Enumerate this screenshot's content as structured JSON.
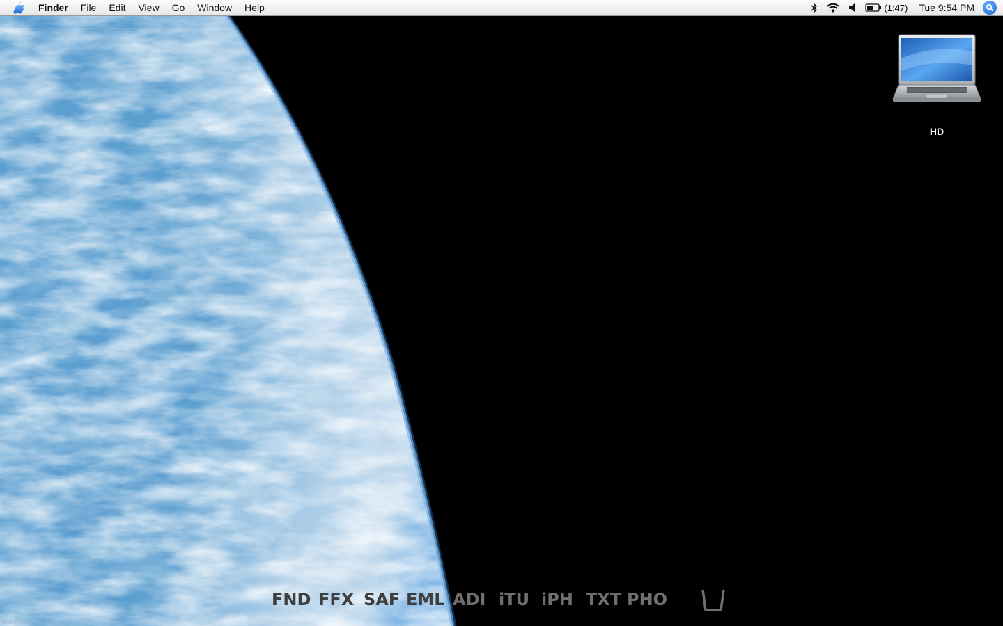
{
  "menubar": {
    "app_name": "Finder",
    "menus": [
      "File",
      "Edit",
      "View",
      "Go",
      "Window",
      "Help"
    ],
    "battery_time": "(1:47)",
    "clock": "Tue 9:54 PM"
  },
  "desktop": {
    "icons": [
      {
        "label": "HD",
        "icon": "laptop-drive-icon"
      }
    ],
    "watermark": "MANDOLUX<<"
  },
  "dock": {
    "items": [
      "FND",
      "FFX",
      "SAF",
      "EML",
      "ADI",
      "iTU",
      "iPH",
      "TXT",
      "PHO"
    ],
    "trash_icon": "trash-icon"
  },
  "colors": {
    "menubar_bg": "#ececec",
    "dock_text": "#3e3e3e",
    "spotlight": "#1a5fd6",
    "background": "#000000"
  }
}
